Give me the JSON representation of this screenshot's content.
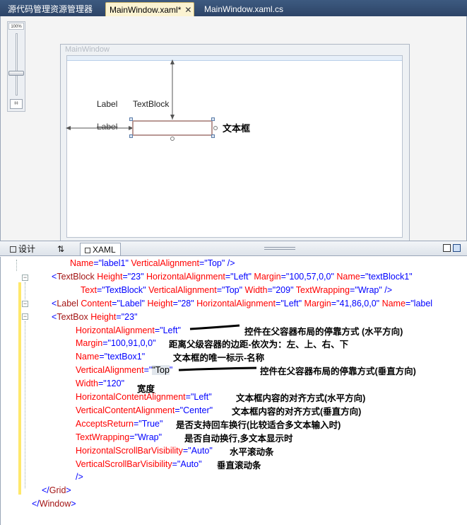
{
  "tabs": [
    {
      "label": "源代码管理资源管理器",
      "active": false
    },
    {
      "label": "MainWindow.xaml*",
      "active": true
    },
    {
      "label": "MainWindow.xaml.cs",
      "active": false
    }
  ],
  "designer": {
    "zoom": "100%",
    "window_title": "MainWindow",
    "label1": "Label",
    "label2": "Label",
    "textblock": "TextBlock",
    "annotation": "文本框"
  },
  "view_tabs": {
    "design": "设计",
    "swap": "⇅",
    "xaml": "XAML"
  },
  "code_lines": [
    {
      "indent": 98,
      "parts": [
        [
          "at",
          "Name"
        ],
        [
          "p",
          "=\""
        ],
        [
          "v",
          "label1"
        ],
        [
          "p",
          "\" "
        ],
        [
          "at",
          "VerticalAlignment"
        ],
        [
          "p",
          "=\""
        ],
        [
          "v",
          "Top"
        ],
        [
          "p",
          "\" />"
        ]
      ]
    },
    {
      "indent": 72,
      "parts": [
        [
          "p",
          "<"
        ],
        [
          "k",
          "TextBlock"
        ],
        [
          "p",
          " "
        ],
        [
          "at",
          "Height"
        ],
        [
          "p",
          "=\""
        ],
        [
          "v",
          "23"
        ],
        [
          "p",
          "\" "
        ],
        [
          "at",
          "HorizontalAlignment"
        ],
        [
          "p",
          "=\""
        ],
        [
          "v",
          "Left"
        ],
        [
          "p",
          "\" "
        ],
        [
          "at",
          "Margin"
        ],
        [
          "p",
          "=\""
        ],
        [
          "v",
          "100,57,0,0"
        ],
        [
          "p",
          "\" "
        ],
        [
          "at",
          "Name"
        ],
        [
          "p",
          "=\""
        ],
        [
          "v",
          "textBlock1"
        ],
        [
          "p",
          "\""
        ]
      ]
    },
    {
      "indent": 113,
      "parts": [
        [
          "at",
          "Text"
        ],
        [
          "p",
          "=\""
        ],
        [
          "v",
          "TextBlock"
        ],
        [
          "p",
          "\" "
        ],
        [
          "at",
          "VerticalAlignment"
        ],
        [
          "p",
          "=\""
        ],
        [
          "v",
          "Top"
        ],
        [
          "p",
          "\" "
        ],
        [
          "at",
          "Width"
        ],
        [
          "p",
          "=\""
        ],
        [
          "v",
          "209"
        ],
        [
          "p",
          "\" "
        ],
        [
          "at",
          "TextWrapping"
        ],
        [
          "p",
          "=\""
        ],
        [
          "v",
          "Wrap"
        ],
        [
          "p",
          "\" />"
        ]
      ]
    },
    {
      "indent": 72,
      "parts": [
        [
          "p",
          "<"
        ],
        [
          "k",
          "Label"
        ],
        [
          "p",
          " "
        ],
        [
          "at",
          "Content"
        ],
        [
          "p",
          "=\""
        ],
        [
          "v",
          "Label"
        ],
        [
          "p",
          "\" "
        ],
        [
          "at",
          "Height"
        ],
        [
          "p",
          "=\""
        ],
        [
          "v",
          "28"
        ],
        [
          "p",
          "\" "
        ],
        [
          "at",
          "HorizontalAlignment"
        ],
        [
          "p",
          "=\""
        ],
        [
          "v",
          "Left"
        ],
        [
          "p",
          "\" "
        ],
        [
          "at",
          "Margin"
        ],
        [
          "p",
          "=\""
        ],
        [
          "v",
          "41,86,0,0"
        ],
        [
          "p",
          "\" "
        ],
        [
          "at",
          "Name"
        ],
        [
          "p",
          "=\""
        ],
        [
          "v",
          "label"
        ]
      ]
    },
    {
      "indent": 72,
      "parts": [
        [
          "p",
          "<"
        ],
        [
          "k",
          "TextBox"
        ],
        [
          "p",
          " "
        ],
        [
          "at",
          "Height"
        ],
        [
          "p",
          "=\""
        ],
        [
          "v",
          "23"
        ],
        [
          "p",
          "\""
        ]
      ]
    },
    {
      "indent": 106,
      "parts": [
        [
          "at",
          "HorizontalAlignment"
        ],
        [
          "p",
          "=\""
        ],
        [
          "v",
          "Left"
        ],
        [
          "p",
          "\""
        ]
      ]
    },
    {
      "indent": 106,
      "parts": [
        [
          "at",
          "Margin"
        ],
        [
          "p",
          "=\""
        ],
        [
          "v",
          "100,91,0,0"
        ],
        [
          "p",
          "\""
        ]
      ]
    },
    {
      "indent": 106,
      "parts": [
        [
          "at",
          "Name"
        ],
        [
          "p",
          "=\""
        ],
        [
          "v",
          "textBox1"
        ],
        [
          "p",
          "\""
        ]
      ]
    },
    {
      "indent": 106,
      "parts": [
        [
          "at",
          "VerticalAlignment"
        ],
        [
          "p",
          "=\""
        ],
        [
          "hl",
          "\"Top"
        ],
        [
          "p",
          "\""
        ]
      ]
    },
    {
      "indent": 106,
      "parts": [
        [
          "at",
          "Width"
        ],
        [
          "p",
          "=\""
        ],
        [
          "v",
          "120"
        ],
        [
          "p",
          "\""
        ]
      ]
    },
    {
      "indent": 106,
      "parts": [
        [
          "at",
          "HorizontalContentAlignment"
        ],
        [
          "p",
          "=\""
        ],
        [
          "v",
          "Left"
        ],
        [
          "p",
          "\""
        ]
      ]
    },
    {
      "indent": 106,
      "parts": [
        [
          "at",
          "VerticalContentAlignment"
        ],
        [
          "p",
          "=\""
        ],
        [
          "v",
          "Center"
        ],
        [
          "p",
          "\""
        ]
      ]
    },
    {
      "indent": 106,
      "parts": [
        [
          "at",
          "AcceptsReturn"
        ],
        [
          "p",
          "=\""
        ],
        [
          "v",
          "True"
        ],
        [
          "p",
          "\""
        ]
      ]
    },
    {
      "indent": 106,
      "parts": [
        [
          "at",
          "TextWrapping"
        ],
        [
          "p",
          "=\""
        ],
        [
          "v",
          "Wrap"
        ],
        [
          "p",
          "\""
        ]
      ]
    },
    {
      "indent": 106,
      "parts": [
        [
          "at",
          "HorizontalScrollBarVisibility"
        ],
        [
          "p",
          "=\""
        ],
        [
          "v",
          "Auto"
        ],
        [
          "p",
          "\""
        ]
      ]
    },
    {
      "indent": 106,
      "parts": [
        [
          "at",
          "VerticalScrollBarVisibility"
        ],
        [
          "p",
          "=\""
        ],
        [
          "v",
          "Auto"
        ],
        [
          "p",
          "\""
        ]
      ]
    },
    {
      "indent": 106,
      "parts": [
        [
          "p",
          "/>"
        ]
      ]
    },
    {
      "indent": 58,
      "parts": [
        [
          "p",
          "</"
        ],
        [
          "k",
          "Grid"
        ],
        [
          "p",
          ">"
        ]
      ]
    },
    {
      "indent": 44,
      "parts": [
        [
          "p",
          "</"
        ],
        [
          "k",
          "Window"
        ],
        [
          "p",
          ">"
        ]
      ]
    }
  ],
  "notes": [
    {
      "line": 5,
      "text": "控件在父容器布局的停靠方式 (水平方向)"
    },
    {
      "line": 6,
      "text": "距离父级容器的边距-依次为：左、上、右、下"
    },
    {
      "line": 7,
      "text": "文本框的唯一标示-名称"
    },
    {
      "line": 8,
      "text": "控件在父容器布局的停靠方式(垂直方向)"
    },
    {
      "line": 9,
      "text": "宽度"
    },
    {
      "line": 10,
      "text": "文本框内容的对齐方式(水平方向)"
    },
    {
      "line": 11,
      "text": "文本框内容的对齐方式(垂直方向)"
    },
    {
      "line": 12,
      "text": "是否支持回车换行(比较适合多文本输入时)"
    },
    {
      "line": 13,
      "text": "是否自动换行,多文本显示时"
    },
    {
      "line": 14,
      "text": "水平滚动条"
    },
    {
      "line": 15,
      "text": "垂直滚动条"
    }
  ]
}
